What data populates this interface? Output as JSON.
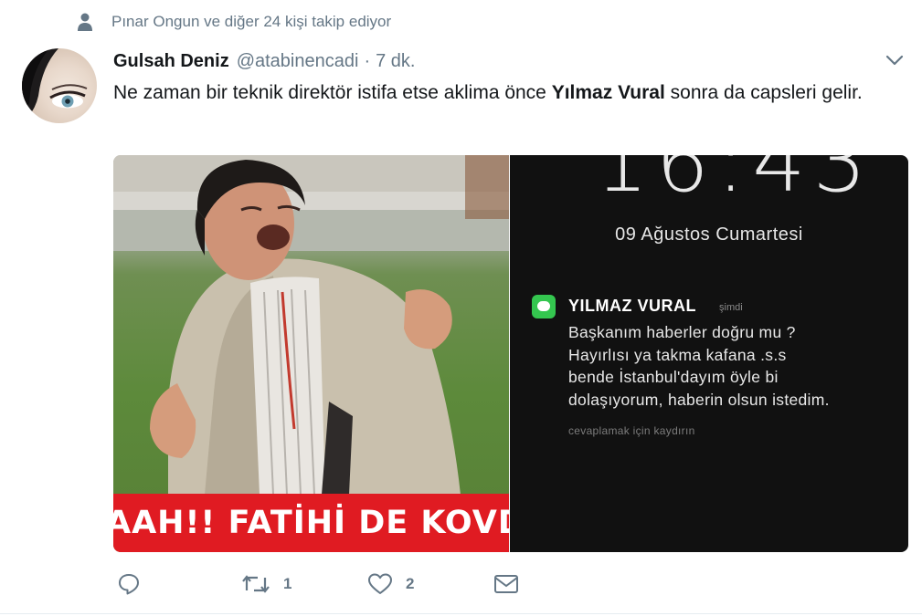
{
  "context": {
    "text": "Pınar Ongun ve diğer 24 kişi takip ediyor",
    "icon": "person-icon"
  },
  "tweet": {
    "display_name": "Gulsah Deniz",
    "handle": "@atabinencadi",
    "dot": "·",
    "time": "7 dk.",
    "text_before": "Ne zaman bir teknik direktör istifa etse aklima önce ",
    "text_bold": "Yılmaz Vural",
    "text_after": " sonra da capsleri gelir."
  },
  "media": {
    "banner_text": "AAH!! FATİHİ DE KOVDU",
    "phone": {
      "clock": "16:43",
      "date": "09 Ağustos Cumartesi",
      "notification": {
        "sender": "YILMAZ VURAL",
        "time": "şimdi",
        "message": "Başkanım haberler doğru mu ?\nHayırlısı ya takma kafana .s.s\nbende İstanbul'dayım öyle bi\ndolaşıyorum, haberin olsun istedim.",
        "hint": "cevaplamak için kaydırın"
      }
    }
  },
  "actions": {
    "reply": {
      "icon": "reply-icon"
    },
    "retweet": {
      "icon": "retweet-icon",
      "count": "1"
    },
    "like": {
      "icon": "heart-icon",
      "count": "2"
    },
    "dm": {
      "icon": "envelope-icon"
    }
  },
  "colors": {
    "secondary_text": "#657786",
    "primary_text": "#14171a",
    "banner_red": "#e01b22",
    "notification_green": "#34c64f"
  }
}
